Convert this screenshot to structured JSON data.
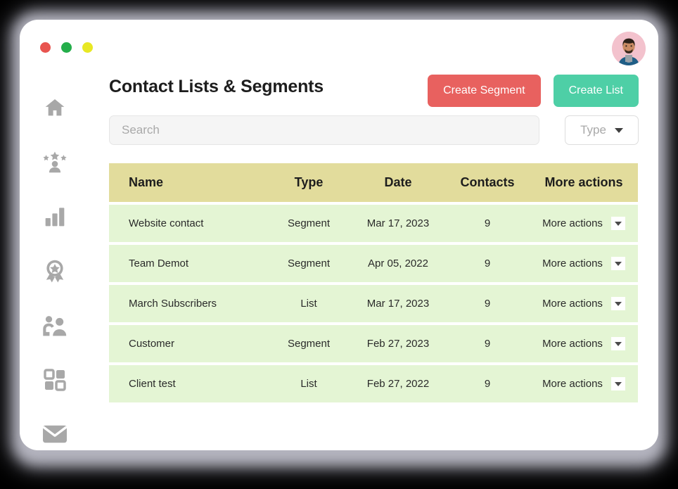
{
  "window": {
    "traffic_lights": [
      {
        "name": "close",
        "color": "#e8544f"
      },
      {
        "name": "minimize",
        "color": "#24ae4b"
      },
      {
        "name": "maximize",
        "color": "#e8e824"
      }
    ]
  },
  "sidebar": {
    "items": [
      {
        "icon": "home-icon",
        "label": "Home"
      },
      {
        "icon": "user-stars-icon",
        "label": "Leads"
      },
      {
        "icon": "bar-chart-icon",
        "label": "Reports"
      },
      {
        "icon": "award-badge-icon",
        "label": "Rewards"
      },
      {
        "icon": "people-team-icon",
        "label": "Contacts"
      },
      {
        "icon": "grid-apps-icon",
        "label": "Apps"
      },
      {
        "icon": "envelope-icon",
        "label": "Mail"
      }
    ]
  },
  "header": {
    "title": "Contact Lists & Segments",
    "create_segment_label": "Create Segment",
    "create_list_label": "Create List",
    "create_segment_color": "#e8615f",
    "create_list_color": "#4ecfa6",
    "avatar_alt": "User avatar"
  },
  "filters": {
    "search_placeholder": "Search",
    "search_value": "",
    "type_label": "Type"
  },
  "table": {
    "header_color": "#e2dc9c",
    "row_color": "#e4f5d4",
    "columns": [
      "Name",
      "Type",
      "Date",
      "Contacts",
      "More actions"
    ],
    "rows": [
      {
        "name": "Website contact",
        "type": "Segment",
        "date": "Mar 17, 2023",
        "contacts": "9",
        "actions": "More actions"
      },
      {
        "name": "Team Demot",
        "type": "Segment",
        "date": "Apr 05, 2022",
        "contacts": "9",
        "actions": "More actions"
      },
      {
        "name": "March Subscribers",
        "type": "List",
        "date": "Mar 17, 2023",
        "contacts": "9",
        "actions": "More actions"
      },
      {
        "name": "Customer",
        "type": "Segment",
        "date": "Feb 27, 2023",
        "contacts": "9",
        "actions": "More actions"
      },
      {
        "name": "Client test",
        "type": "List",
        "date": "Feb 27, 2022",
        "contacts": "9",
        "actions": "More actions"
      }
    ]
  }
}
